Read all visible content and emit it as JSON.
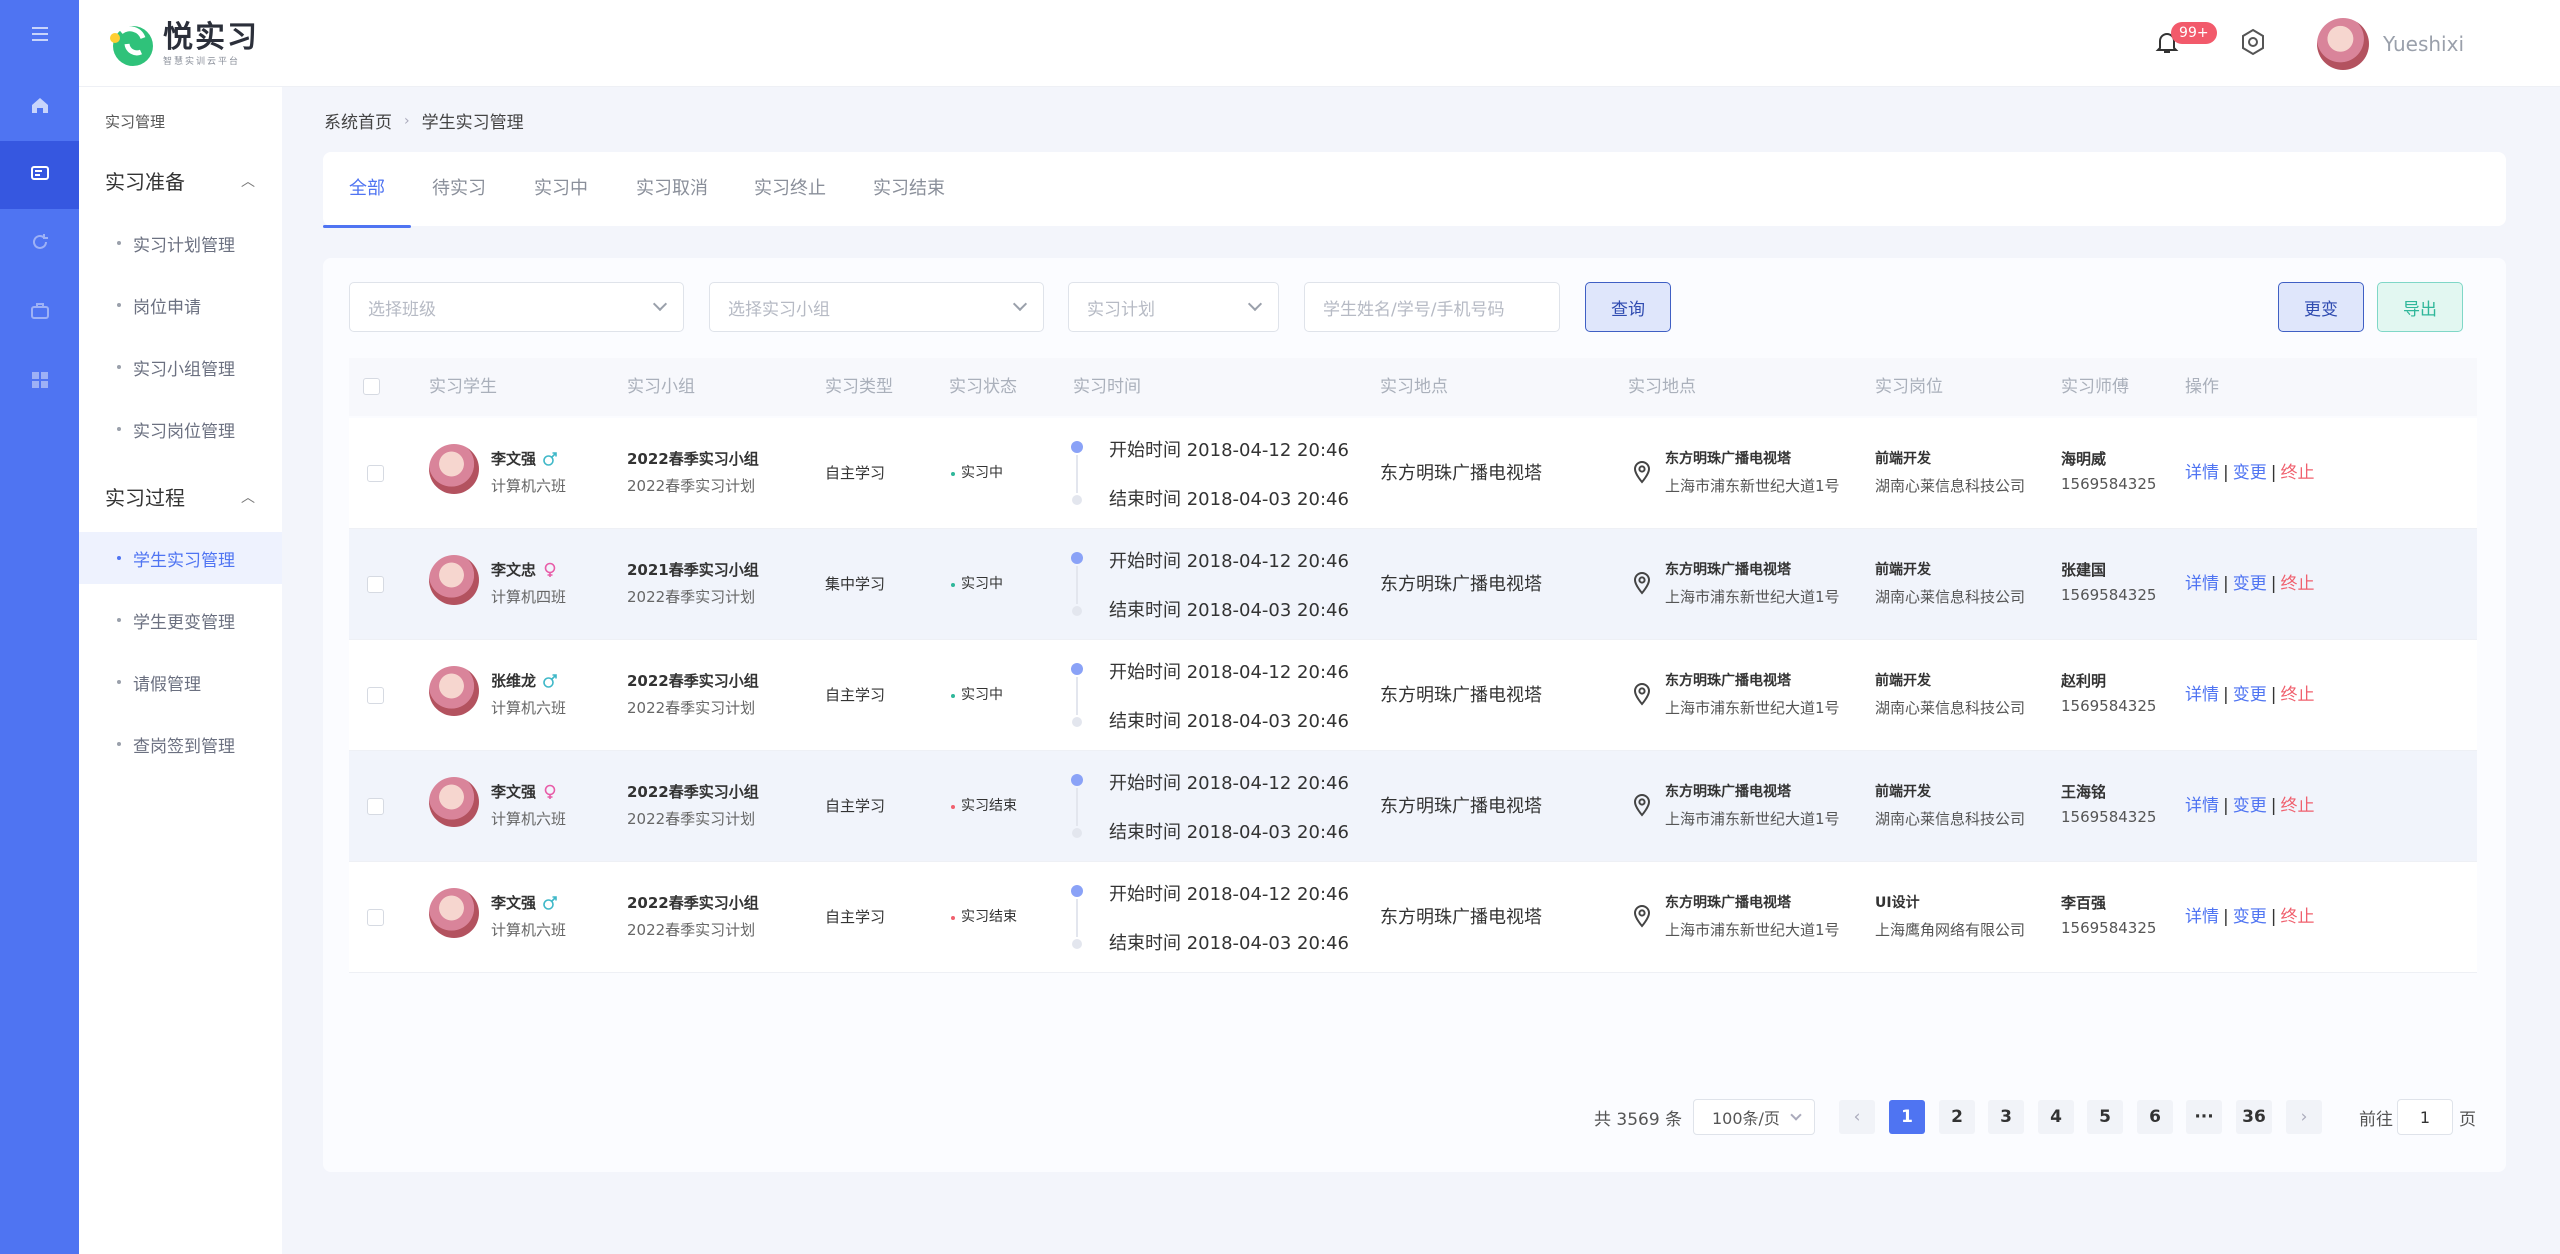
{
  "app": {
    "logo_title": "悦实习",
    "logo_subtitle": "智慧实训云平台"
  },
  "header": {
    "notif_badge": "99+",
    "username": "Yueshixi"
  },
  "sidebar": {
    "section_title": "实习管理",
    "group1": "实习准备",
    "group1_items": [
      "实习计划管理",
      "岗位申请",
      "实习小组管理",
      "实习岗位管理"
    ],
    "group2": "实习过程",
    "group2_items": [
      "学生实习管理",
      "学生更变管理",
      "请假管理",
      "查岗签到管理"
    ]
  },
  "breadcrumb": {
    "home": "系统首页",
    "current": "学生实习管理"
  },
  "tabs": [
    "全部",
    "待实习",
    "实习中",
    "实习取消",
    "实习终止",
    "实习结束"
  ],
  "filters": {
    "class_placeholder": "选择班级",
    "group_placeholder": "选择实习小组",
    "plan_placeholder": "实习计划",
    "search_placeholder": "学生姓名/学号/手机号码",
    "query_label": "查询",
    "change_label": "更变",
    "export_label": "导出"
  },
  "table": {
    "columns": [
      "实习学生",
      "实习小组",
      "实习类型",
      "实习状态",
      "实习时间",
      "实习地点",
      "实习地点",
      "实习岗位",
      "实习师傅",
      "操作"
    ],
    "rows": [
      {
        "name": "李文强",
        "gender": "male",
        "class": "计算机六班",
        "group": "2022春季实习小组",
        "plan": "2022春季实习计划",
        "type": "自主学习",
        "status": "实习中",
        "status_color": "#2fb79a",
        "start": "开始时间 2018-04-12 20:46",
        "end": "结束时间 2018-04-03 20:46",
        "location": "东方明珠广播电视塔",
        "addr_name": "东方明珠广播电视塔",
        "addr": "上海市浦东新世纪大道1号",
        "position": "前端开发",
        "company": "湖南心莱信息科技公司",
        "mentor": "海明威",
        "mentor_phone": "1569584325"
      },
      {
        "name": "李文忠",
        "gender": "female",
        "class": "计算机四班",
        "group": "2021春季实习小组",
        "plan": "2022春季实习计划",
        "type": "集中学习",
        "status": "实习中",
        "status_color": "#2fb79a",
        "start": "开始时间 2018-04-12 20:46",
        "end": "结束时间 2018-04-03 20:46",
        "location": "东方明珠广播电视塔",
        "addr_name": "东方明珠广播电视塔",
        "addr": "上海市浦东新世纪大道1号",
        "position": "前端开发",
        "company": "湖南心莱信息科技公司",
        "mentor": "张建国",
        "mentor_phone": "1569584325"
      },
      {
        "name": "张维龙",
        "gender": "male",
        "class": "计算机六班",
        "group": "2022春季实习小组",
        "plan": "2022春季实习计划",
        "type": "自主学习",
        "status": "实习中",
        "status_color": "#2fb79a",
        "start": "开始时间 2018-04-12 20:46",
        "end": "结束时间 2018-04-03 20:46",
        "location": "东方明珠广播电视塔",
        "addr_name": "东方明珠广播电视塔",
        "addr": "上海市浦东新世纪大道1号",
        "position": "前端开发",
        "company": "湖南心莱信息科技公司",
        "mentor": "赵利明",
        "mentor_phone": "1569584325"
      },
      {
        "name": "李文强",
        "gender": "female",
        "class": "计算机六班",
        "group": "2022春季实习小组",
        "plan": "2022春季实习计划",
        "type": "自主学习",
        "status": "实习结束",
        "status_color": "#f0606e",
        "start": "开始时间 2018-04-12 20:46",
        "end": "结束时间 2018-04-03 20:46",
        "location": "东方明珠广播电视塔",
        "addr_name": "东方明珠广播电视塔",
        "addr": "上海市浦东新世纪大道1号",
        "position": "前端开发",
        "company": "湖南心莱信息科技公司",
        "mentor": "王海铭",
        "mentor_phone": "1569584325"
      },
      {
        "name": "李文强",
        "gender": "male",
        "class": "计算机六班",
        "group": "2022春季实习小组",
        "plan": "2022春季实习计划",
        "type": "自主学习",
        "status": "实习结束",
        "status_color": "#f0606e",
        "start": "开始时间 2018-04-12 20:46",
        "end": "结束时间 2018-04-03 20:46",
        "location": "东方明珠广播电视塔",
        "addr_name": "东方明珠广播电视塔",
        "addr": "上海市浦东新世纪大道1号",
        "position": "UI设计",
        "company": "上海鹰角网络有限公司",
        "mentor": "李百强",
        "mentor_phone": "1569584325"
      }
    ],
    "ops": {
      "detail": "详情",
      "change": "变更",
      "stop": "终止",
      "sep": "|"
    }
  },
  "pagination": {
    "total": "共 3569 条",
    "page_size": "100条/页",
    "pages": [
      "1",
      "2",
      "3",
      "4",
      "5",
      "6",
      "···",
      "36"
    ],
    "current": "1",
    "prev": "‹",
    "next": "›",
    "goto_prefix": "前往",
    "goto_value": "1",
    "goto_suffix": "页"
  },
  "colors": {
    "primary": "#4f74f2",
    "rail": "#4f74f2",
    "danger": "#f0606e",
    "success": "#2fb79a"
  }
}
